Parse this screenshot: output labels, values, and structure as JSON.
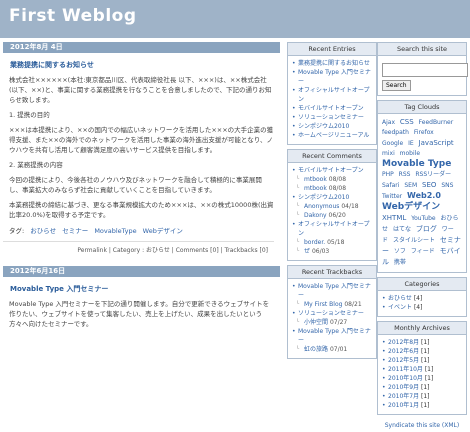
{
  "site": {
    "title": "First Weblog"
  },
  "entries": [
    {
      "date": "2012年8月 4日",
      "title": "業務提携に関するお知らせ",
      "paragraphs": [
        "株式会社××××××(本社:東京都品川区、代表取締役社長 以下、×××)は、××株式会社(以下、××)と、事業に関する業務提携を行なうことを合意しましたので、下記の通りお知らせ致します。",
        "1. 提携の目的",
        "×××は本提携により、××の国内での幅広いネットワークを活用した×××の大手企業の獲得支援、また××の海外でのネットワークを活用した事業の海外進出支援が可能となり、ノウハウを共有し活用して顧客満足度の高いサービス提供を目指します。",
        "2. 業務提携の内容",
        "今回の提携により、今後各社のノウハウ及びネットワークを融合して積極的に事業展開し、事業拡大のみならず社会に貢献していくことを目指していきます。",
        "本業務提携の締結に基づき、更なる事業規模拡大のため×××は、××の株式10000株(出資比率20.0%)を取得する予定です。"
      ],
      "tags_label": "タグ:",
      "tags": [
        "おひらせ",
        "セミナー",
        "MovableType",
        "Webデザイン"
      ],
      "footer": "Permalink | Category : おひらせ | Comments [0] | Trackbacks [0]"
    },
    {
      "date": "2012年6月16日",
      "title": "Movable Type 入門セミナー",
      "paragraphs": [
        "Movable Type 入門セミナーを下記の通り開催します。自分で更新できるウェブサイトを作りたい、ウェブサイトを使って集客したい、売上を上げたい、成果を出したいという方々へ向けたセミナーです。"
      ]
    }
  ],
  "recent_entries": {
    "title": "Recent Entries",
    "items": [
      "業務提携に関するお知らせ",
      "Movable Type 入門セミナー",
      "オフィシャルサイトオープン",
      "モバイルサイトオープン",
      "ソリューションセミナー",
      "シンポジウム2010",
      "ホームページリニューアル"
    ]
  },
  "recent_comments": {
    "title": "Recent Comments",
    "items": [
      {
        "entry": "モバイルサイトオープン",
        "sub": [
          {
            "author": "mtbook",
            "date": "08/08"
          },
          {
            "author": "mtbook",
            "date": "08/08"
          }
        ]
      },
      {
        "entry": "シンポジウム2010",
        "sub": [
          {
            "author": "Anonymous",
            "date": "04/18"
          },
          {
            "author": "Dakony",
            "date": "06/20"
          }
        ]
      },
      {
        "entry": "オフィシャルサイトオープン",
        "sub": [
          {
            "author": "border.",
            "date": "05/18"
          },
          {
            "author": "ぜ",
            "date": "06/03"
          }
        ]
      }
    ]
  },
  "recent_trackbacks": {
    "title": "Recent Trackbacks",
    "items": [
      {
        "entry": "Movable Type 入門セミナー",
        "sub": [
          {
            "author": "My First Blog",
            "date": "08/21"
          }
        ]
      },
      {
        "entry": "ソリューションセミナー",
        "sub": [
          {
            "author": "小仲空間",
            "date": "07/27"
          }
        ]
      },
      {
        "entry": "Movable Type 入門セミナー",
        "sub": [
          {
            "author": "虹の旅路",
            "date": "07/01"
          }
        ]
      }
    ]
  },
  "search": {
    "title": "Search this site",
    "button": "Search"
  },
  "tag_clouds": {
    "title": "Tag Clouds",
    "tags": [
      "Ajax",
      "CSS",
      "FeedBurner",
      "feedpath",
      "Firefox",
      "Google",
      "IE",
      "JavaScript",
      "mixi",
      "mobile",
      "Movable Type",
      "PHP",
      "RSS",
      "RSSリーダー",
      "Safari",
      "SEM",
      "SEO",
      "SNS",
      "Twitter",
      "Web2.0",
      "Webデザイン",
      "XHTML",
      "YouTube",
      "おひらせ",
      "はてな",
      "ブログ",
      "ワード",
      "スタイルシート",
      "セミナー",
      "ソフ",
      "フィード",
      "モバイル",
      "携帯"
    ]
  },
  "categories": {
    "title": "Categories",
    "items": [
      {
        "name": "おひらせ",
        "count": "[4]"
      },
      {
        "name": "イベント",
        "count": "[4]"
      }
    ]
  },
  "monthly_archives": {
    "title": "Monthly Archives",
    "items": [
      {
        "month": "2012年8月",
        "count": "[1]"
      },
      {
        "month": "2012年6月",
        "count": "[1]"
      },
      {
        "month": "2012年5月",
        "count": "[1]"
      },
      {
        "month": "2011年10月",
        "count": "[1]"
      },
      {
        "month": "2010年10月",
        "count": "[1]"
      },
      {
        "month": "2010年9月",
        "count": "[1]"
      },
      {
        "month": "2010年7月",
        "count": "[1]"
      },
      {
        "month": "2010年1月",
        "count": "[1]"
      }
    ]
  },
  "syndicate": "Syndicate this site (XML)"
}
